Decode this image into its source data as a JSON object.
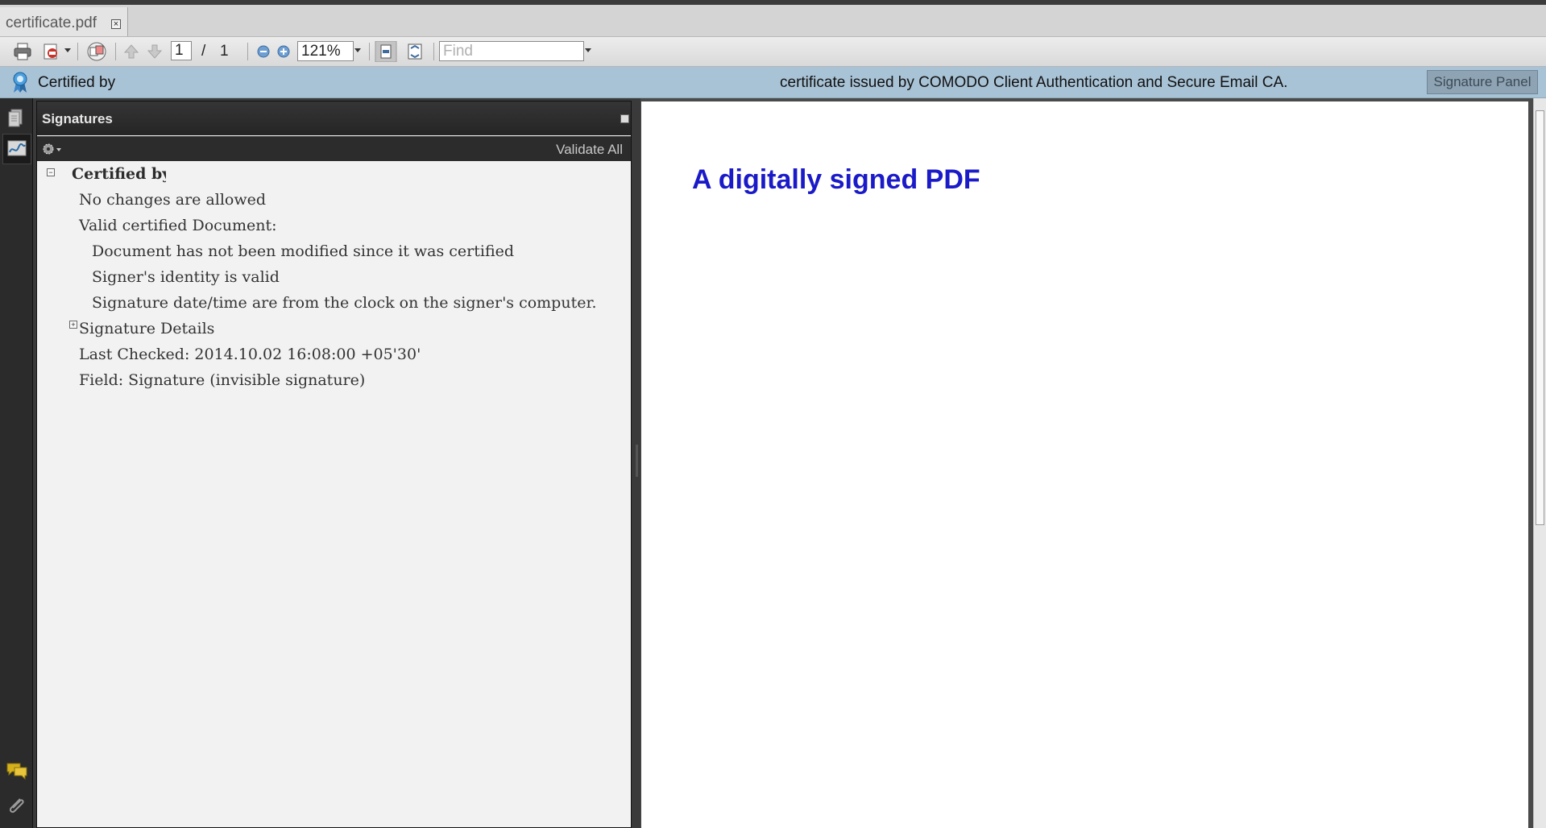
{
  "tab": {
    "title": "certificate.pdf",
    "close_glyph": "×"
  },
  "toolbar": {
    "page_current": "1",
    "page_separator": "/",
    "page_total": "1",
    "zoom": "121%",
    "find_placeholder": "Find"
  },
  "message_bar": {
    "left_text": "Certified by",
    "right_text": "certificate issued by COMODO Client Authentication and Secure Email CA.",
    "button_label": "Signature Panel"
  },
  "signatures_panel": {
    "title": "Signatures",
    "validate_all": "Validate All",
    "certified_by": "Certified by",
    "items": {
      "no_changes": "No changes are allowed",
      "valid_certified": "Valid certified Document:",
      "not_modified": "Document has not been modified since it was certified",
      "identity_valid": "Signer's identity is valid",
      "clock": "Signature date/time are from the clock on the signer's computer.",
      "details": "Signature Details",
      "last_checked": "Last Checked: 2014.10.02 16:08:00 +05'30'",
      "field": "Field: Signature (invisible signature)"
    }
  },
  "document": {
    "heading": "A digitally signed PDF"
  },
  "colors": {
    "heading": "#1a1ac8",
    "message_bar": "#a9c3d6",
    "panel_header": "#2c2c2c"
  }
}
